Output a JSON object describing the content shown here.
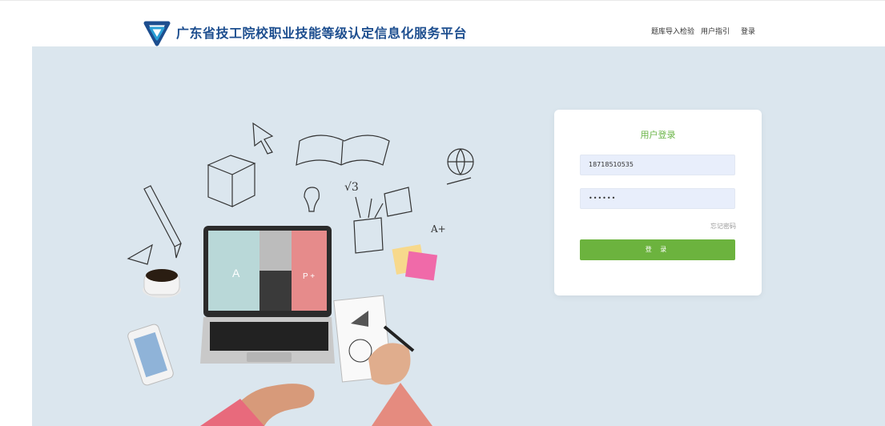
{
  "header": {
    "title": "广东省技工院校职业技能等级认定信息化服务平台",
    "logo_icon": "interlocking-triangle-logo-icon",
    "nav": [
      "题库导入检验",
      "用户指引",
      "登录"
    ]
  },
  "login": {
    "title": "用户登录",
    "phone_value": "18718510535",
    "password_value": "••••••",
    "forgot": "忘记密码",
    "submit": "登 录"
  },
  "colors": {
    "brand": "#1d4e8f",
    "brand_accent": "#2a9fd6",
    "primary_green": "#6cb33e",
    "hero_bg": "#dbe6ee",
    "input_bg": "#e8eefb"
  }
}
